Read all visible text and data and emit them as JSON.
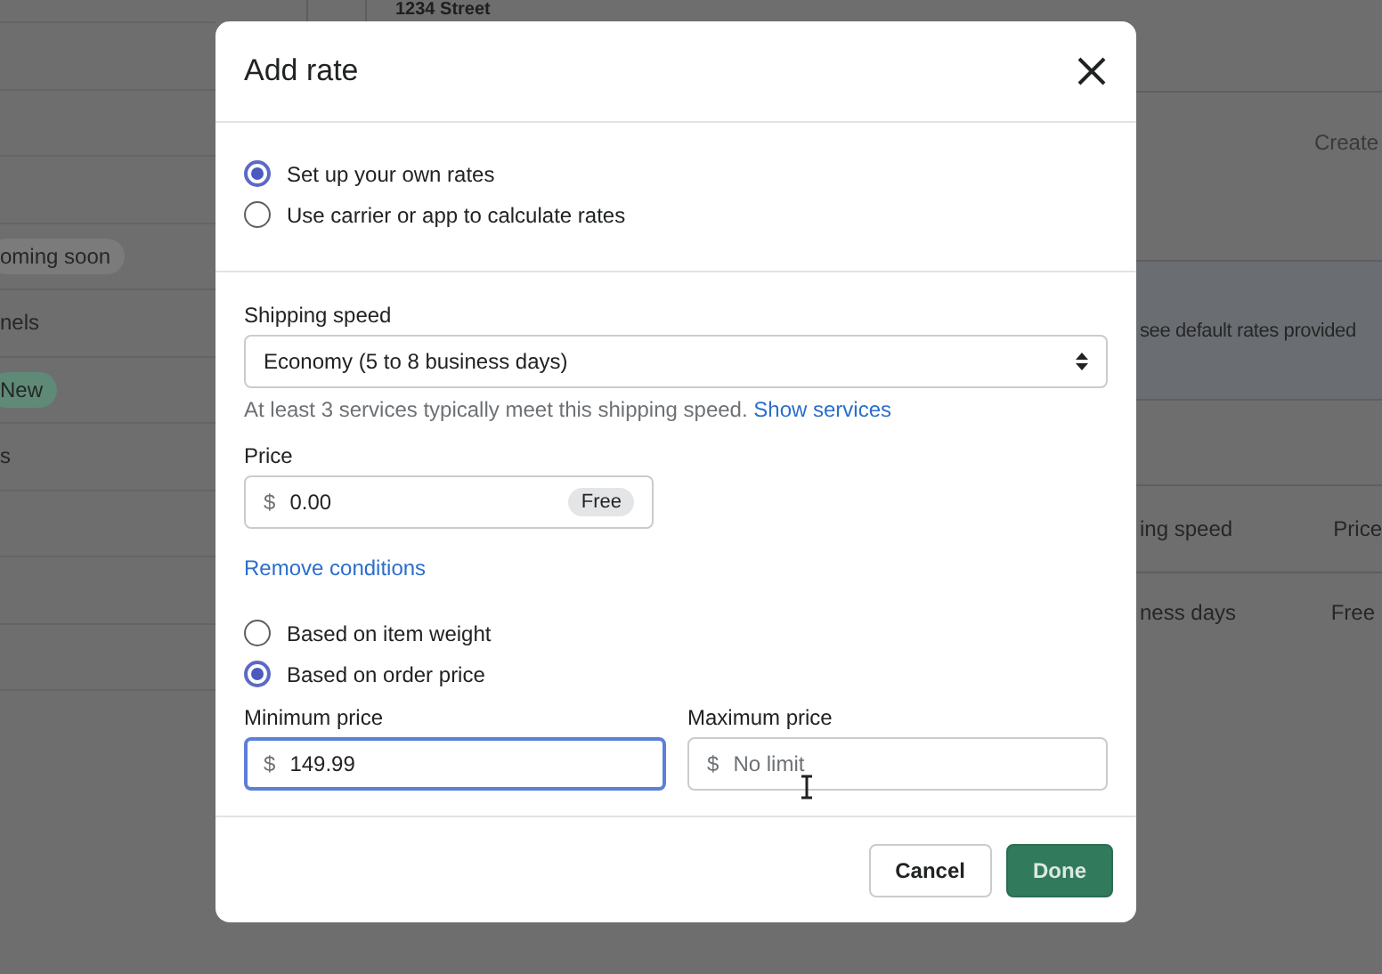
{
  "background": {
    "address": "1234 Street",
    "sidebar_rows": [
      {
        "kind": "empty"
      },
      {
        "kind": "empty"
      },
      {
        "kind": "empty"
      },
      {
        "kind": "badge",
        "label": "oming soon",
        "color": "#7b7b7b"
      },
      {
        "kind": "text",
        "label": "nels"
      },
      {
        "kind": "badge",
        "label": "New",
        "color": "#5f8a78"
      },
      {
        "kind": "text",
        "label": "s"
      },
      {
        "kind": "empty"
      },
      {
        "kind": "empty"
      },
      {
        "kind": "empty"
      },
      {
        "kind": "empty"
      }
    ],
    "create_link": "Create",
    "banner_text": "see default rates provided",
    "table": {
      "columns": [
        "ing speed",
        "Price"
      ],
      "rows": [
        [
          "ness days",
          "Free"
        ]
      ]
    }
  },
  "modal": {
    "title": "Add rate",
    "rate_type": [
      {
        "label": "Set up your own rates",
        "selected": true
      },
      {
        "label": "Use carrier or app to calculate rates",
        "selected": false
      }
    ],
    "shipping_speed": {
      "label": "Shipping speed",
      "value": "Economy (5 to 8 business days)",
      "help": "At least 3 services typically meet this shipping speed.",
      "help_link": "Show services"
    },
    "price": {
      "label": "Price",
      "prefix": "$",
      "value": "0.00",
      "badge": "Free"
    },
    "remove_conditions": "Remove conditions",
    "condition_type": [
      {
        "label": "Based on item weight",
        "selected": false
      },
      {
        "label": "Based on order price",
        "selected": true
      }
    ],
    "minimum_price": {
      "label": "Minimum price",
      "prefix": "$",
      "value": "149.99",
      "focused": true
    },
    "maximum_price": {
      "label": "Maximum price",
      "prefix": "$",
      "placeholder": "No limit",
      "focused": false
    },
    "buttons": [
      {
        "kind": "secondary",
        "label": "Cancel"
      },
      {
        "kind": "primary",
        "label": "Done"
      }
    ]
  }
}
